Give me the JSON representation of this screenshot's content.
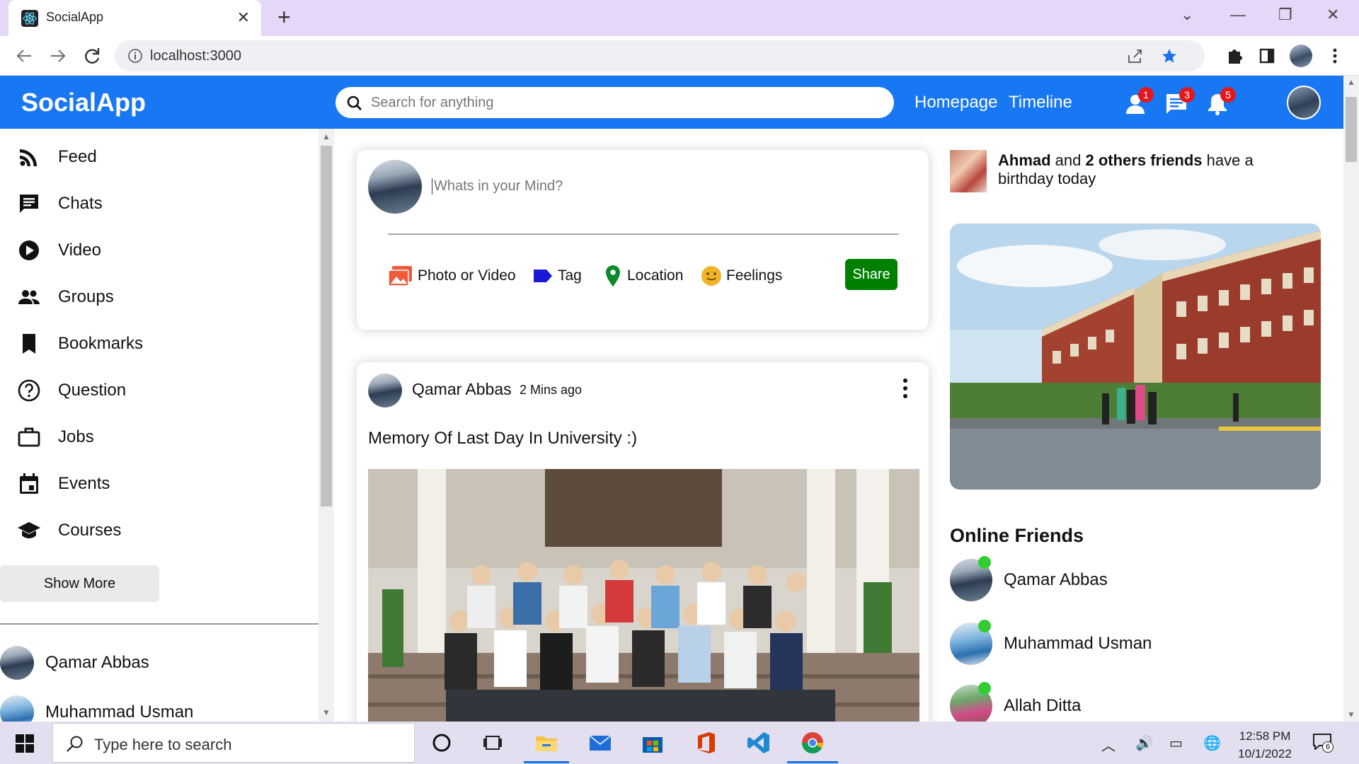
{
  "browser": {
    "tab_title": "SocialApp",
    "url": "localhost:3000"
  },
  "header": {
    "logo": "SocialApp",
    "search_placeholder": "Search for anything",
    "links": [
      "Homepage",
      "Timeline"
    ],
    "badges": {
      "friends": "1",
      "messages": "3",
      "notifications": "5"
    }
  },
  "sidebar": {
    "items": [
      {
        "label": "Feed",
        "icon": "rss-icon"
      },
      {
        "label": "Chats",
        "icon": "chat-icon"
      },
      {
        "label": "Video",
        "icon": "play-circle-icon"
      },
      {
        "label": "Groups",
        "icon": "group-icon"
      },
      {
        "label": "Bookmarks",
        "icon": "bookmark-icon"
      },
      {
        "label": "Question",
        "icon": "help-circle-icon"
      },
      {
        "label": "Jobs",
        "icon": "briefcase-icon"
      },
      {
        "label": "Events",
        "icon": "calendar-icon"
      },
      {
        "label": "Courses",
        "icon": "school-icon"
      }
    ],
    "show_more": "Show More",
    "friends": [
      "Qamar Abbas",
      "Muhammad Usman"
    ]
  },
  "share": {
    "placeholder": "Whats in your Mind?",
    "options": [
      "Photo or Video",
      "Tag",
      "Location",
      "Feelings"
    ],
    "share_button": "Share"
  },
  "post": {
    "author": "Qamar Abbas",
    "time": "2 Mins ago",
    "text": "Memory Of Last Day In University :)"
  },
  "rightbar": {
    "birthday_name": "Ahmad",
    "birthday_mid": " and ",
    "birthday_count": "2 others friends",
    "birthday_tail": " have a birthday today",
    "online_title": "Online Friends",
    "online_friends": [
      "Qamar Abbas",
      "Muhammad Usman",
      "Allah Ditta"
    ]
  },
  "taskbar": {
    "search_placeholder": "Type here to search",
    "time": "12:58 PM",
    "date": "10/1/2022",
    "notification_count": "6"
  },
  "colors": {
    "brand": "#1877f2",
    "share_button": "#008000",
    "badge": "#e4171c",
    "online": "#32cd32"
  }
}
